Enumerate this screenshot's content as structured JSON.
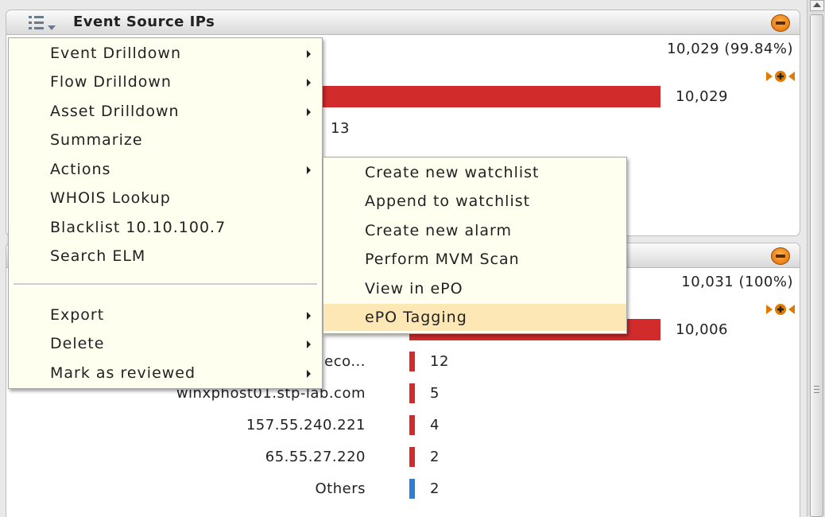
{
  "panel1": {
    "title": "Event Source IPs",
    "total": "10,029 (99.84%)",
    "rows": [
      {
        "label": "",
        "value": "10,029",
        "fraction": 1.0
      },
      {
        "label": "",
        "value": "13",
        "fraction": 0.0
      }
    ]
  },
  "panel2": {
    "total": "10,031 (100%)",
    "rows": [
      {
        "label": "",
        "value": "10,006",
        "fraction": 1.0
      },
      {
        "label": "...teleco...",
        "value": "12"
      },
      {
        "label": "winxphost01.stp-lab.com",
        "value": "5"
      },
      {
        "label": "157.55.240.221",
        "value": "4"
      },
      {
        "label": "65.55.27.220",
        "value": "2"
      },
      {
        "label": "Others",
        "value": "2"
      }
    ]
  },
  "context_menu": {
    "items": [
      {
        "label": "Event Drilldown",
        "submenu": true
      },
      {
        "label": "Flow Drilldown",
        "submenu": true
      },
      {
        "label": "Asset Drilldown",
        "submenu": true
      },
      {
        "label": "Summarize",
        "submenu": false
      },
      {
        "label": "Actions",
        "submenu": true
      },
      {
        "label": "WHOIS Lookup",
        "submenu": false
      },
      {
        "label": "Blacklist 10.10.100.7",
        "submenu": false
      },
      {
        "label": "Search ELM",
        "submenu": false
      }
    ],
    "items_after_separator": [
      {
        "label": "Export",
        "submenu": true
      },
      {
        "label": "Delete",
        "submenu": true
      },
      {
        "label": "Mark as reviewed",
        "submenu": true
      }
    ]
  },
  "actions_submenu": {
    "items": [
      {
        "label": "Create new watchlist"
      },
      {
        "label": "Append to watchlist"
      },
      {
        "label": "Create new alarm"
      },
      {
        "label": "Perform MVM Scan"
      },
      {
        "label": "View in ePO"
      },
      {
        "label": "ePO Tagging",
        "highlighted": true
      }
    ]
  },
  "colors": {
    "bar_red": "#d22b2b",
    "bar_blue": "#2d7fd3",
    "menu_bg": "#fffff0",
    "highlight": "#fde7b5",
    "collapse_button": "#f08a10"
  },
  "icons": {
    "panel_menu": "list-menu-icon",
    "collapse": "collapse-button-icon",
    "expand": "expand-arrows-icon"
  }
}
